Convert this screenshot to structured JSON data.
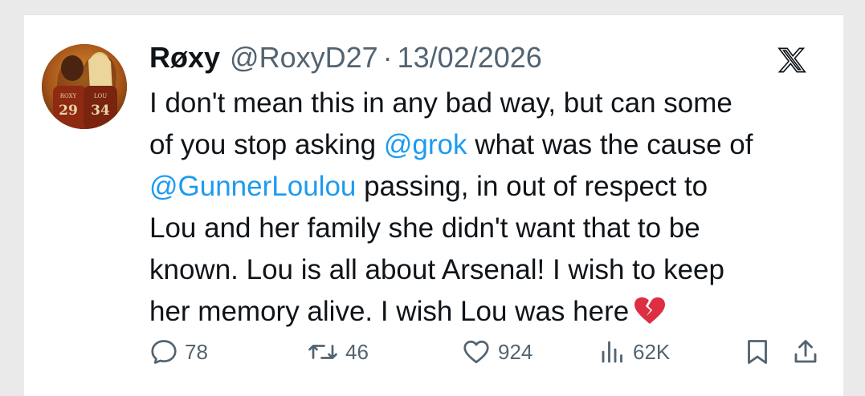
{
  "tweet": {
    "display_name": "Røxy",
    "handle": "@RoxyD27",
    "separator": "·",
    "date": "13/02/2026",
    "body": {
      "line1": "I don't mean this in any bad way, but can some",
      "line2_pre": "of you stop asking ",
      "mention_grok": "@grok",
      "line2_post": " what was the cause of",
      "mention_gunner": "@GunnerLoulou",
      "line3_post": " passing, in out of respect to",
      "line4": "Lou and her family she didn't want that to be",
      "line5": "known. Lou is all about Arsenal! I wish to keep",
      "line6": "her memory alive. I wish Lou was here"
    },
    "avatar": {
      "jersey_left_name": "ROXY",
      "jersey_left_number": "29",
      "jersey_right_name": "LOU",
      "jersey_right_number": "34"
    },
    "stats": {
      "replies": "78",
      "reposts": "46",
      "likes": "924",
      "views": "62K"
    },
    "icons": [
      "x-logo-icon",
      "broken-heart-emoji-icon",
      "reply-icon",
      "repost-icon",
      "like-icon",
      "views-icon",
      "bookmark-icon",
      "share-icon"
    ],
    "colors": {
      "mention": "#1d9bf0",
      "text": "#0f1419",
      "secondary": "#536471"
    }
  }
}
